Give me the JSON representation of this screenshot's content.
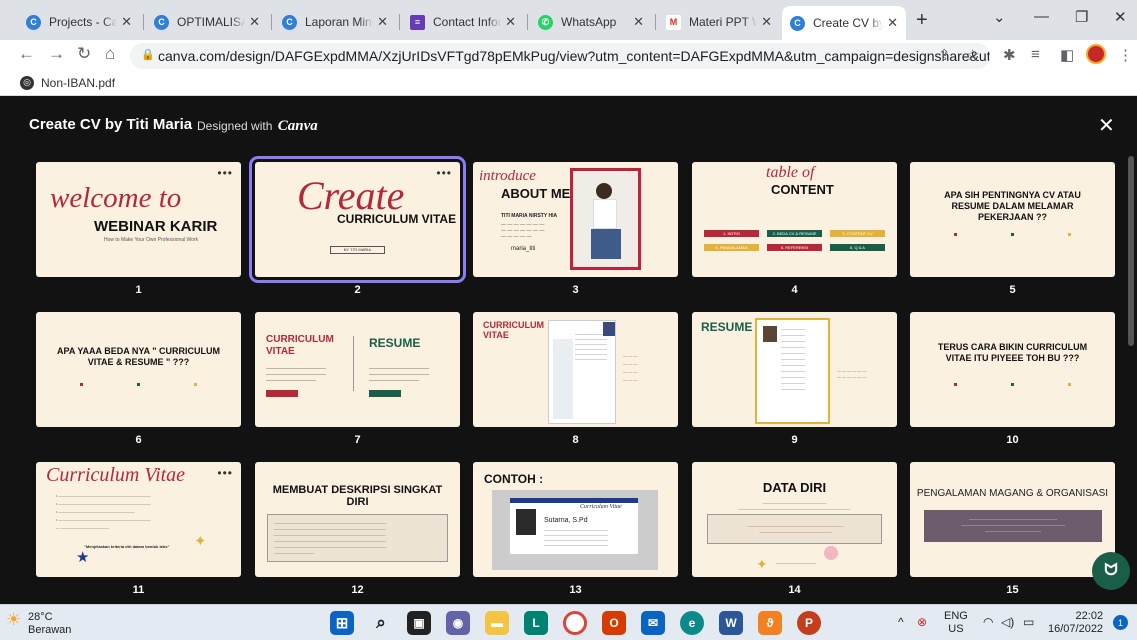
{
  "tabs": [
    {
      "title": "Projects - Canva",
      "icon": "canva-icon"
    },
    {
      "title": "OPTIMALISASI",
      "icon": "canva-icon"
    },
    {
      "title": "Laporan Minggu",
      "icon": "canva-icon"
    },
    {
      "title": "Contact Information",
      "icon": "forms-icon"
    },
    {
      "title": "WhatsApp",
      "icon": "whatsapp-icon"
    },
    {
      "title": "Materi PPT We",
      "icon": "gmail-icon"
    },
    {
      "title": "Create CV by Ti",
      "icon": "canva-icon"
    }
  ],
  "address_bar": {
    "url": "canva.com/design/DAFGExpdMMA/XzjUrIDsVFTgd78pEMkPug/view?utm_content=DAFGExpdMMA&utm_campaign=designshare&utm_m..."
  },
  "bookmark": {
    "label": "Non-IBAN.pdf"
  },
  "viewer": {
    "title": "Create CV by Titi Maria",
    "designed_with": "Designed with",
    "brand": "Canva"
  },
  "slides": [
    {
      "num": "1",
      "script": "welcome to",
      "heading": "WEBINAR KARIR",
      "small": "How to Make Your Own Professional Work"
    },
    {
      "num": "2",
      "script": "Create",
      "heading": "CURRICULUM VITAE",
      "small": "BY TITI MARIA"
    },
    {
      "num": "3",
      "script": "introduce",
      "heading": "ABOUT ME",
      "name": "TITI MARIA NIRSTY HIA",
      "handle": "maria_titi"
    },
    {
      "num": "4",
      "script": "table of",
      "heading": "CONTENT",
      "items": [
        "1. INTRO",
        "2. BEDA CV & RESUME",
        "3. CONTENT CV",
        "4. PENGALAMAN",
        "5. REFERENSI",
        "6. Q & A"
      ]
    },
    {
      "num": "5",
      "heading": "APA SIH PENTINGNYA CV ATAU RESUME DALAM MELAMAR PEKERJAAN ??"
    },
    {
      "num": "6",
      "heading": "APA YAAA BEDA NYA \" CURRICULUM VITAE & RESUME \" ???"
    },
    {
      "num": "7",
      "left": "CURRICULUM VITAE",
      "right": "RESUME"
    },
    {
      "num": "8",
      "left": "CURRICULUM VITAE"
    },
    {
      "num": "9",
      "left": "RESUME"
    },
    {
      "num": "10",
      "heading": "TERUS CARA BIKIN CURRICULUM VITAE ITU PIYEEE TOH BU ???"
    },
    {
      "num": "11",
      "script": "Curriculum Vitae",
      "quote": "\"Menjelaskan kriteria diri dalam bentuk teks\""
    },
    {
      "num": "12",
      "heading": "MEMBUAT DESKRIPSI SINGKAT DIRI"
    },
    {
      "num": "13",
      "heading": "CONTOH :",
      "card_title": "Curriculum Vitae",
      "card_name": "Sutarna, S.Pd"
    },
    {
      "num": "14",
      "heading": "DATA DIRI"
    },
    {
      "num": "15",
      "heading": "PENGALAMAN MAGANG & ORGANISASI"
    }
  ],
  "taskbar": {
    "temperature": "28°C",
    "weather": "Berawan",
    "lang": "ENG",
    "region": "US",
    "time": "22:02",
    "date": "16/07/2022",
    "notifications": "1"
  },
  "colors": {
    "accent": "#8b7cf6",
    "slide_bg": "#fbf1e1",
    "viewer_bg": "#121212",
    "maroon": "#b5283a",
    "teal": "#1a5e4a",
    "gold": "#e2b23a"
  }
}
